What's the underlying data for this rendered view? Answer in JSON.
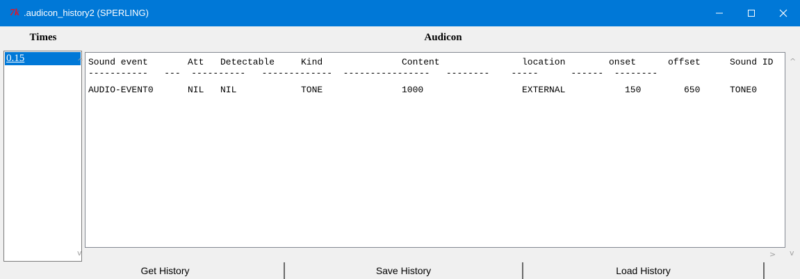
{
  "window": {
    "title": ".audicon_history2 (SPERLING)",
    "logo": "7k",
    "accent": "#0078d7"
  },
  "times": {
    "header": "Times",
    "items": [
      "0.15"
    ]
  },
  "audicon": {
    "header": "Audicon",
    "columns": [
      "Sound event",
      "Att",
      "Detectable",
      "Kind",
      "Content",
      "location",
      "onset",
      "offset",
      "Sound ID"
    ],
    "dash_line": "-----------   ---  ----------   -------------  ----------------   --------    -----      ------  --------",
    "rows": [
      [
        "AUDIO-EVENT0",
        "NIL",
        "NIL",
        "TONE",
        "1000",
        "EXTERNAL",
        "150",
        "650",
        "TONE0"
      ]
    ]
  },
  "buttons": {
    "get": "Get History",
    "save": "Save History",
    "load": "Load History"
  }
}
